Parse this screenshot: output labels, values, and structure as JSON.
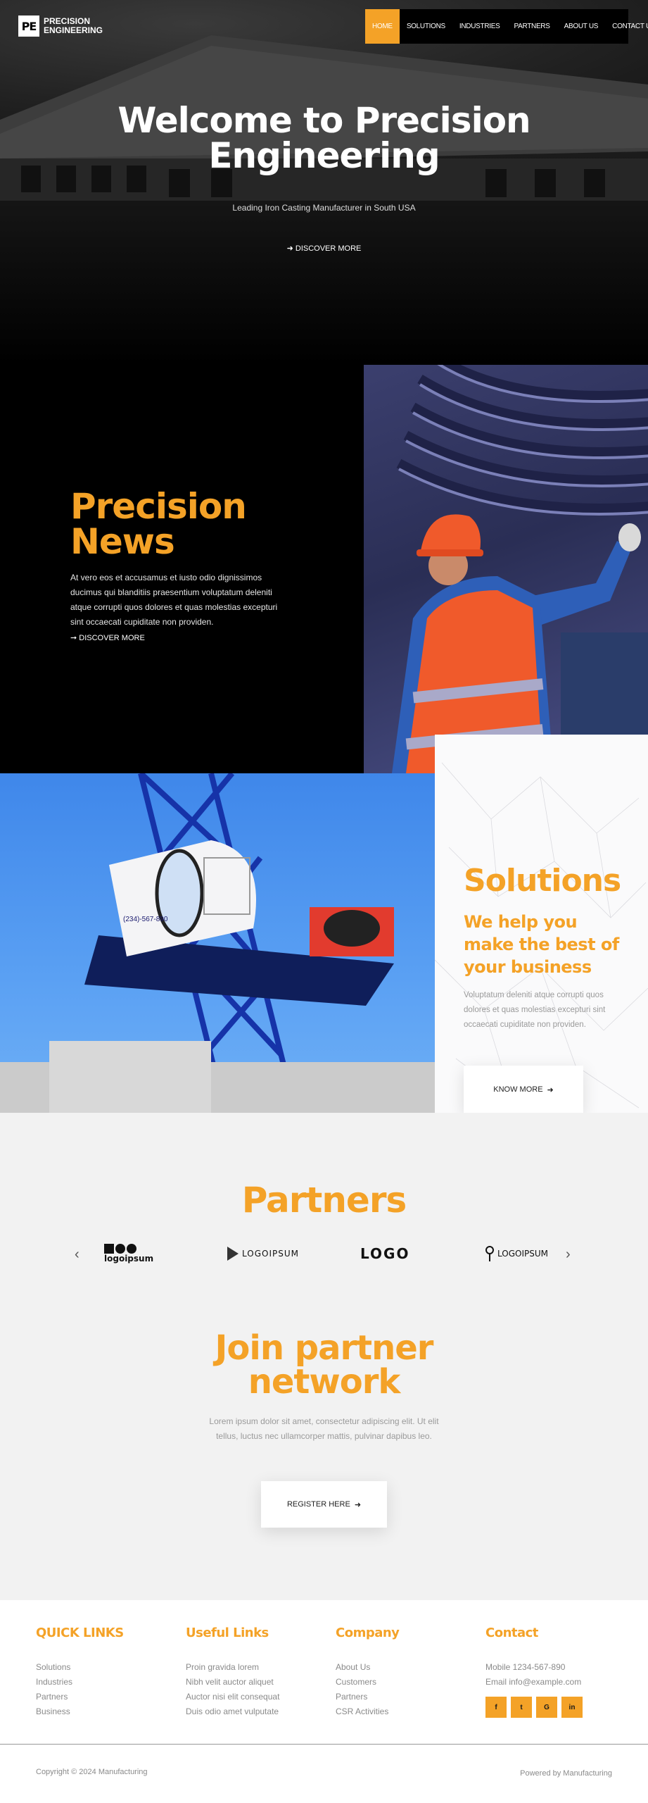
{
  "brand": {
    "mark": "PE",
    "line1": "PRECISION",
    "line2": "ENGINEERING"
  },
  "nav": [
    {
      "label": "HOME"
    },
    {
      "label": "SOLUTIONS"
    },
    {
      "label": "INDUSTRIES"
    },
    {
      "label": "PARTNERS"
    },
    {
      "label": "ABOUT US"
    },
    {
      "label": "CONTACT US"
    }
  ],
  "hero": {
    "title_line1": "Welcome to Precision",
    "title_line2": "Engineering",
    "subtitle": "Leading Iron Casting Manufacturer in South USA",
    "cta": "DISCOVER MORE"
  },
  "news": {
    "title_line1": "Precision",
    "title_line2": "News",
    "body": "At vero eos et accusamus et iusto odio dignissimos ducimus qui blanditiis praesentium voluptatum deleniti atque corrupti quos dolores et quas molestias excepturi sint occaecati cupiditate non providen.",
    "cta": "DISCOVER MORE"
  },
  "solutions": {
    "title": "Solutions",
    "subtitle": "We help you make the best of your business",
    "body": "Voluptatum deleniti atque corrupti quos dolores et quas molestias excepturi sint occaecati cupiditate non providen.",
    "button": "KNOW MORE"
  },
  "crane": {
    "phone": "(234)-567-890"
  },
  "partners": {
    "title": "Partners",
    "logos": [
      "logoipsum",
      "LOGOIPSUM",
      "LOGO",
      "LOGOIPSUM"
    ],
    "join_line1": "Join partner",
    "join_line2": "network",
    "join_body": "Lorem ipsum dolor sit amet, consectetur adipiscing elit. Ut elit tellus, luctus nec ullamcorper mattis, pulvinar dapibus leo.",
    "button": "REGISTER HERE"
  },
  "footer": {
    "quick_links": {
      "title": "QUICK LINKS",
      "items": [
        "Solutions",
        "Industries",
        "Partners",
        "Business"
      ]
    },
    "useful_links": {
      "title": "Useful Links",
      "items": [
        "Proin gravida lorem",
        "Nibh velit auctor aliquet",
        "Auctor nisi elit consequat",
        "Duis odio amet vulputate"
      ]
    },
    "company": {
      "title": "Company",
      "items": [
        "About Us",
        "Customers",
        "Partners",
        "CSR Activities"
      ]
    },
    "contact": {
      "title": "Contact",
      "mobile": "Mobile 1234-567-890",
      "email": "Email info@example.com"
    },
    "social": [
      {
        "icon": "facebook-icon",
        "glyph": "f"
      },
      {
        "icon": "twitter-icon",
        "glyph": "t"
      },
      {
        "icon": "google-icon",
        "glyph": "G"
      },
      {
        "icon": "linkedin-icon",
        "glyph": "in"
      }
    ],
    "copyright": "Copyright © 2024 Manufacturing",
    "powered": "Powered by Manufacturing"
  },
  "colors": {
    "accent": "#f4a227",
    "dark": "#000000",
    "light_bg": "#f2f2f2"
  }
}
